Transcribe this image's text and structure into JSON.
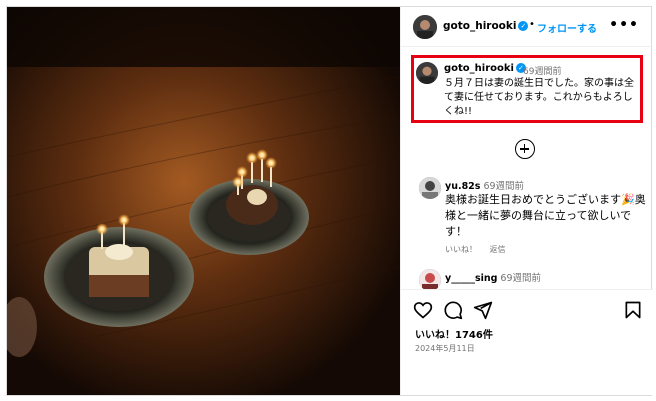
{
  "post": {
    "username": "goto_hirooki",
    "separator": "•",
    "follow_label": "フォローする",
    "more_label": "•••"
  },
  "caption": {
    "username": "goto_hirooki",
    "time": "69週間前",
    "text": "５月７日は妻の誕生日でした。家の事は全て妻に任せております。これからもよろしくね!!"
  },
  "comments": [
    {
      "username": "yu.82s",
      "time": "69週間前",
      "text": "奥様お誕生日おめでとうございます🎉奥様と一緒に夢の舞台に立って欲しいです！",
      "like_label": "いいね！",
      "reply_label": "返信"
    },
    {
      "username": "y_____sing",
      "time": "69週間前",
      "text": ""
    }
  ],
  "footer": {
    "likes": "いいね！1746件",
    "date": "2024年5月11日"
  },
  "icons": [
    "heart-icon",
    "comment-icon",
    "share-icon",
    "bookmark-icon",
    "plus-circle-icon",
    "verified-icon",
    "more-icon"
  ],
  "colors": {
    "accent": "#0095f6",
    "highlight": "#e60012",
    "muted": "#737373"
  }
}
